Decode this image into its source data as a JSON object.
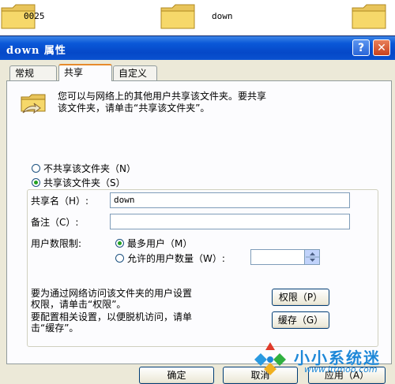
{
  "desktop": {
    "items": [
      {
        "label": "0025"
      },
      {
        "label": "down"
      },
      {
        "label": ""
      }
    ]
  },
  "dialog": {
    "title": "down 属性",
    "help_label": "?",
    "close_label": "✕",
    "tabs": [
      {
        "label": "常规"
      },
      {
        "label": "共享"
      },
      {
        "label": "自定义"
      }
    ],
    "active_tab": "共享"
  },
  "sharing": {
    "description_line1": "您可以与网络上的其他用户共享该文件夹。要共享",
    "description_line2": "该文件夹，请单击“共享该文件夹”。",
    "no_share_label": "不共享该文件夹（N）",
    "share_label": "共享该文件夹（S）",
    "share_selected": true,
    "share_name_label": "共享名（H）:",
    "share_name_value": "down",
    "comment_label": "备注（C）:",
    "comment_value": "",
    "user_limit_label": "用户数限制:",
    "max_users_label": "最多用户（M）",
    "max_users_selected": true,
    "allow_users_label": "允许的用户数量（W）:",
    "allow_users_value": "",
    "permissions_text_line1": "要为通过网络访问该文件夹的用户设置",
    "permissions_text_line2": "权限，请单击“权限”。",
    "permissions_button": "权限（P）",
    "cache_text_line1": "要配置相关设置，以便脱机访问，请单",
    "cache_text_line2": "击“缓存”。",
    "cache_button": "缓存（G）"
  },
  "footer": {
    "ok_button": "确定",
    "cancel_button": "取消",
    "apply_button": "应用（A）"
  },
  "watermark": {
    "title": "小小系统迷",
    "url": "www.ittmoo.com"
  },
  "colors": {
    "titlebar": "#0548c8",
    "dialog_bg": "#ece9d8",
    "tab_accent": "#e68b2c",
    "watermark": "#1e88d8"
  }
}
